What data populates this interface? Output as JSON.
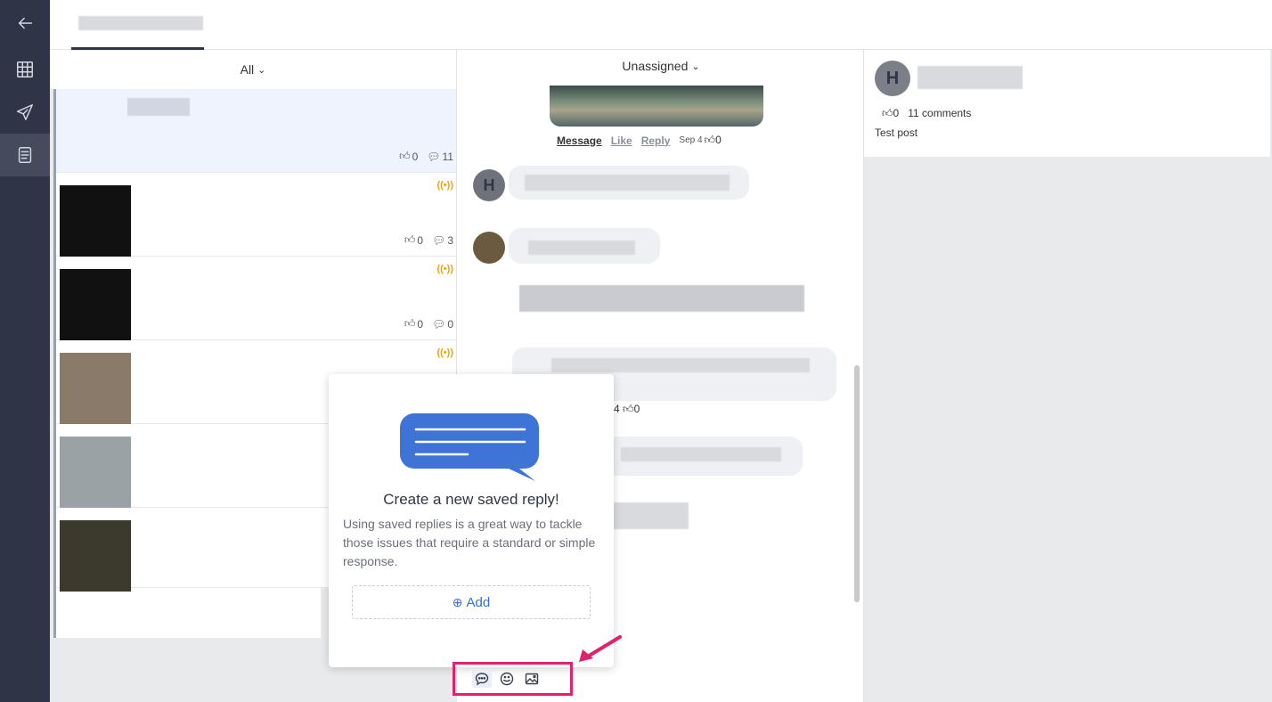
{
  "nav": {
    "items": [
      {
        "name": "back",
        "icon": "back-arrow-icon"
      },
      {
        "name": "dashboard",
        "icon": "grid-icon"
      },
      {
        "name": "publish",
        "icon": "paper-plane-icon"
      },
      {
        "name": "inbox",
        "icon": "document-list-icon",
        "active": true
      }
    ]
  },
  "list": {
    "filter_label": "All",
    "items": [
      {
        "likes": "0",
        "comments": "11",
        "selected": true
      },
      {
        "likes": "0",
        "comments": "3",
        "live": true
      },
      {
        "likes": "0",
        "comments": "0",
        "live": true
      },
      {
        "live": true
      },
      {},
      {}
    ]
  },
  "conversation": {
    "assignee_label": "Unassigned",
    "actions": {
      "message": "Message",
      "like": "Like",
      "reply": "Reply",
      "date": "Sep 4",
      "likes": "0"
    },
    "avatar_letter": "H",
    "partial_date": "4",
    "partial_likes": "0"
  },
  "post": {
    "avatar_letter": "H",
    "likes": "0",
    "comments_label": "11 comments",
    "text": "Test post"
  },
  "saved_reply_popup": {
    "title": "Create a new saved reply!",
    "description": "Using saved replies is a great way to tackle those issues that require a standard or simple response.",
    "add_label": "Add"
  },
  "composer": {
    "tools": [
      "saved-reply-icon",
      "emoji-icon",
      "image-icon"
    ]
  },
  "colors": {
    "nav_bg": "#2f3447",
    "accent": "#2f6fd6",
    "highlight": "#e0226c",
    "live": "#f0a400"
  }
}
